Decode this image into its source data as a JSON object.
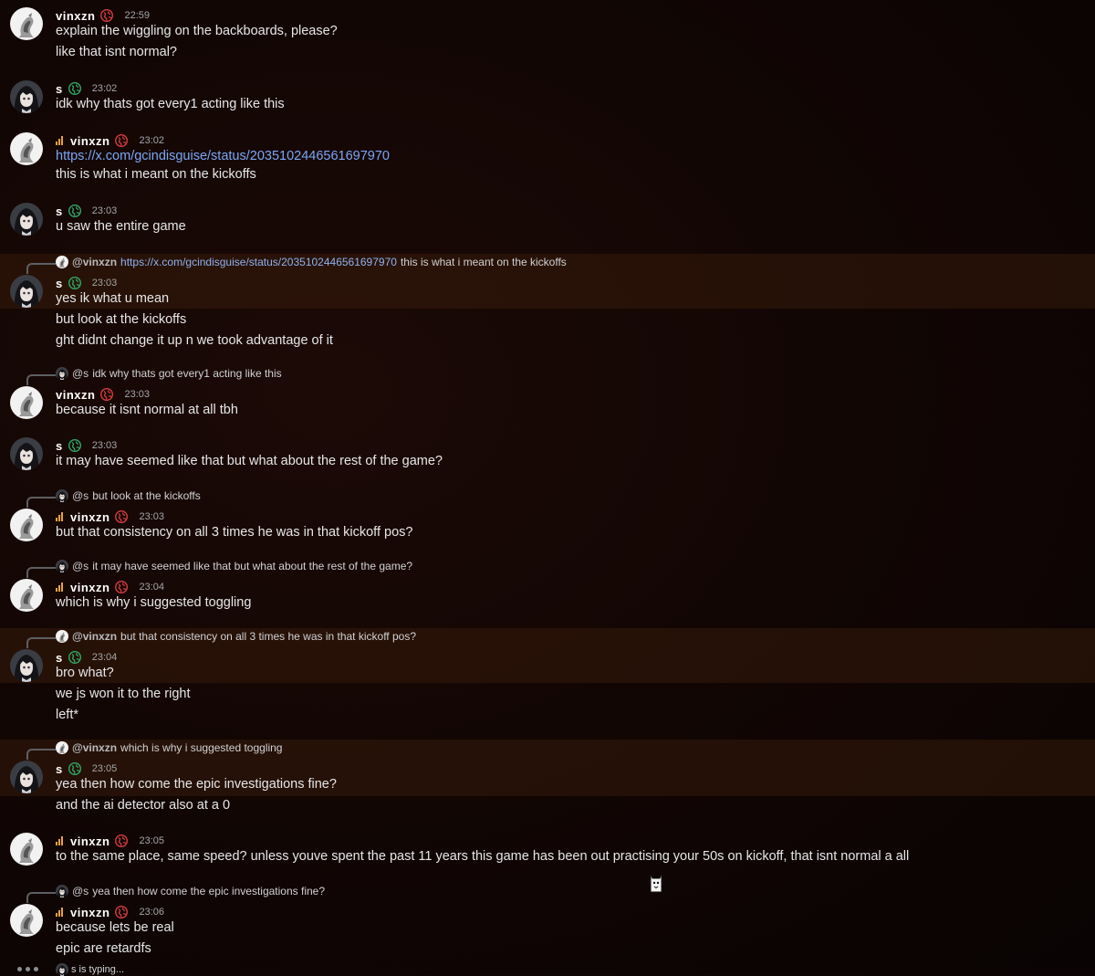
{
  "colors": {
    "link": "#7aa7f5",
    "globe_red": "#d83c3e",
    "globe_green": "#2fa866",
    "signal": "#e9a23b",
    "highlight": "#3e1e0a"
  },
  "users": {
    "vinxzn": "vinxzn",
    "s": "s"
  },
  "messages": [
    {
      "author": "vinxzn",
      "time": "22:59",
      "lines": [
        "explain the wiggling on the backboards, please?",
        "like that isnt normal?"
      ]
    },
    {
      "author": "s",
      "time": "23:02",
      "lines": [
        "idk why thats got every1 acting like this"
      ]
    },
    {
      "author": "vinxzn",
      "time": "23:02",
      "link": "https://x.com/gcindisguise/status/2035102446561697970",
      "lines": [
        "this is what i meant on the kickoffs"
      ]
    },
    {
      "author": "s",
      "time": "23:03",
      "lines": [
        "u saw the entire game"
      ]
    },
    {
      "author": "s",
      "time": "23:03",
      "reply": {
        "name": "@vinxzn",
        "link": "https://x.com/gcindisguise/status/2035102446561697970",
        "text": "this is what i meant on the kickoffs"
      },
      "lines": [
        "yes ik what u mean",
        "but look at the kickoffs",
        "ght didnt change it up n we took advantage of it"
      ]
    },
    {
      "author": "vinxzn",
      "time": "23:03",
      "reply": {
        "name": "@s",
        "text": "idk why thats got every1 acting like this"
      },
      "lines": [
        "because it isnt normal at all tbh"
      ]
    },
    {
      "author": "s",
      "time": "23:03",
      "lines": [
        "it may have seemed like that but what about the rest of the game?"
      ]
    },
    {
      "author": "vinxzn",
      "time": "23:03",
      "reply": {
        "name": "@s",
        "text": "but look at the kickoffs"
      },
      "lines": [
        "but that consistency on all 3 times he was in that kickoff pos?"
      ]
    },
    {
      "author": "vinxzn",
      "time": "23:04",
      "reply": {
        "name": "@s",
        "text": "it may have seemed like that but what about the rest of the game?"
      },
      "lines": [
        "which is why i suggested toggling"
      ]
    },
    {
      "author": "s",
      "time": "23:04",
      "reply": {
        "name": "@vinxzn",
        "text": "but that consistency on all 3 times he was in that kickoff pos?"
      },
      "lines": [
        "bro what?",
        "we js won it to the right",
        "left*"
      ]
    },
    {
      "author": "s",
      "time": "23:05",
      "reply": {
        "name": "@vinxzn",
        "text": "which is why i suggested toggling"
      },
      "lines": [
        "yea then how come the epic investigations fine?",
        "and the ai detector also at a 0"
      ]
    },
    {
      "author": "vinxzn",
      "time": "23:05",
      "lines": [
        "to the same place, same speed? unless youve spent the past 11 years this game has been out practising your 50s on kickoff, that isnt normal a all"
      ]
    },
    {
      "author": "vinxzn",
      "time": "23:06",
      "reply": {
        "name": "@s",
        "text": "yea then how come the epic investigations fine?"
      },
      "lines": [
        "because lets be real",
        "epic are retardfs"
      ]
    }
  ],
  "typing": "s is typing..."
}
